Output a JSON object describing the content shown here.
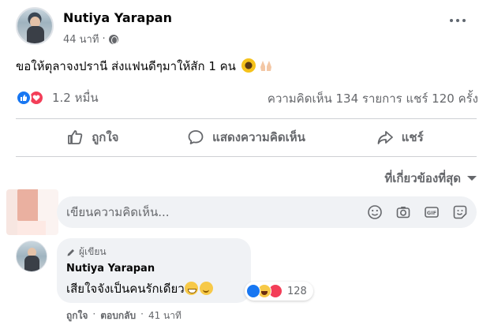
{
  "post": {
    "author": "Nutiya Yarapan",
    "time": "44 นาที",
    "text": "ขอให้ตุลาจงปรานี ส่งแฟนดีๆมาให้สัก 1 คน",
    "reaction_count": "1.2 หมื่น",
    "comments_count": "ความคิดเห็น 134 รายการ",
    "shares_count": "แชร์ 120 ครั้ง"
  },
  "actions": {
    "like": "ถูกใจ",
    "comment": "แสดงความคิดเห็น",
    "share": "แชร์"
  },
  "sort": {
    "label": "ที่เกี่ยวข้องที่สุด"
  },
  "composer": {
    "placeholder": "เขียนความคิดเห็น..."
  },
  "comment": {
    "badge": "ผู้เขียน",
    "author": "Nutiya Yarapan",
    "text": "เสียใจจังเป็นคนรักเดียว",
    "reaction_count": "128",
    "like": "ถูกใจ",
    "reply": "ตอบกลับ",
    "time": "41 นาที",
    "sep1": "·",
    "sep2": "·"
  },
  "colors": {
    "accent": "#1877f2",
    "love": "#f33e58",
    "muted": "#65676b",
    "bubble": "#f0f2f5"
  }
}
